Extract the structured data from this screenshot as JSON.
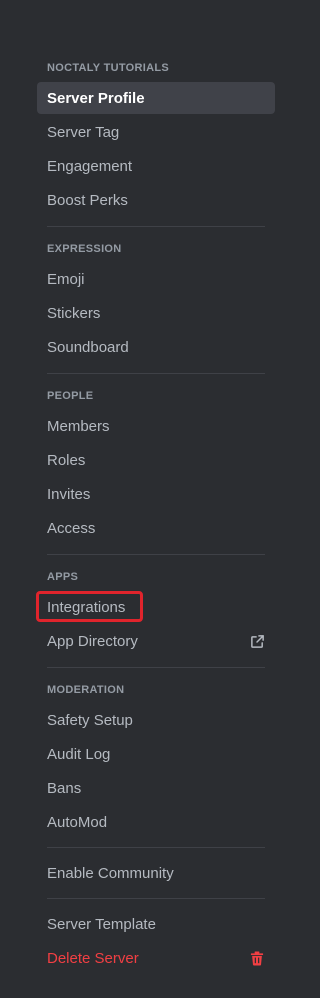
{
  "sections": {
    "server": {
      "heading": "NOCTALY TUTORIALS",
      "items": [
        "Server Profile",
        "Server Tag",
        "Engagement",
        "Boost Perks"
      ]
    },
    "expression": {
      "heading": "EXPRESSION",
      "items": [
        "Emoji",
        "Stickers",
        "Soundboard"
      ]
    },
    "people": {
      "heading": "PEOPLE",
      "items": [
        "Members",
        "Roles",
        "Invites",
        "Access"
      ]
    },
    "apps": {
      "heading": "APPS",
      "items": [
        "Integrations",
        "App Directory"
      ]
    },
    "moderation": {
      "heading": "MODERATION",
      "items": [
        "Safety Setup",
        "Audit Log",
        "Bans",
        "AutoMod"
      ]
    },
    "community": {
      "items": [
        "Enable Community"
      ]
    },
    "footer": {
      "items": [
        "Server Template",
        "Delete Server"
      ]
    }
  },
  "selected_item": "Server Profile",
  "highlighted_item": "Integrations",
  "icons": {
    "app_directory": "external-link-icon",
    "delete_server": "trash-icon"
  },
  "colors": {
    "background": "#2b2d31",
    "selected_background": "#404249",
    "text": "#b5bac1",
    "heading": "#949ba4",
    "danger": "#f23f43",
    "highlight_border": "#e0242c"
  }
}
